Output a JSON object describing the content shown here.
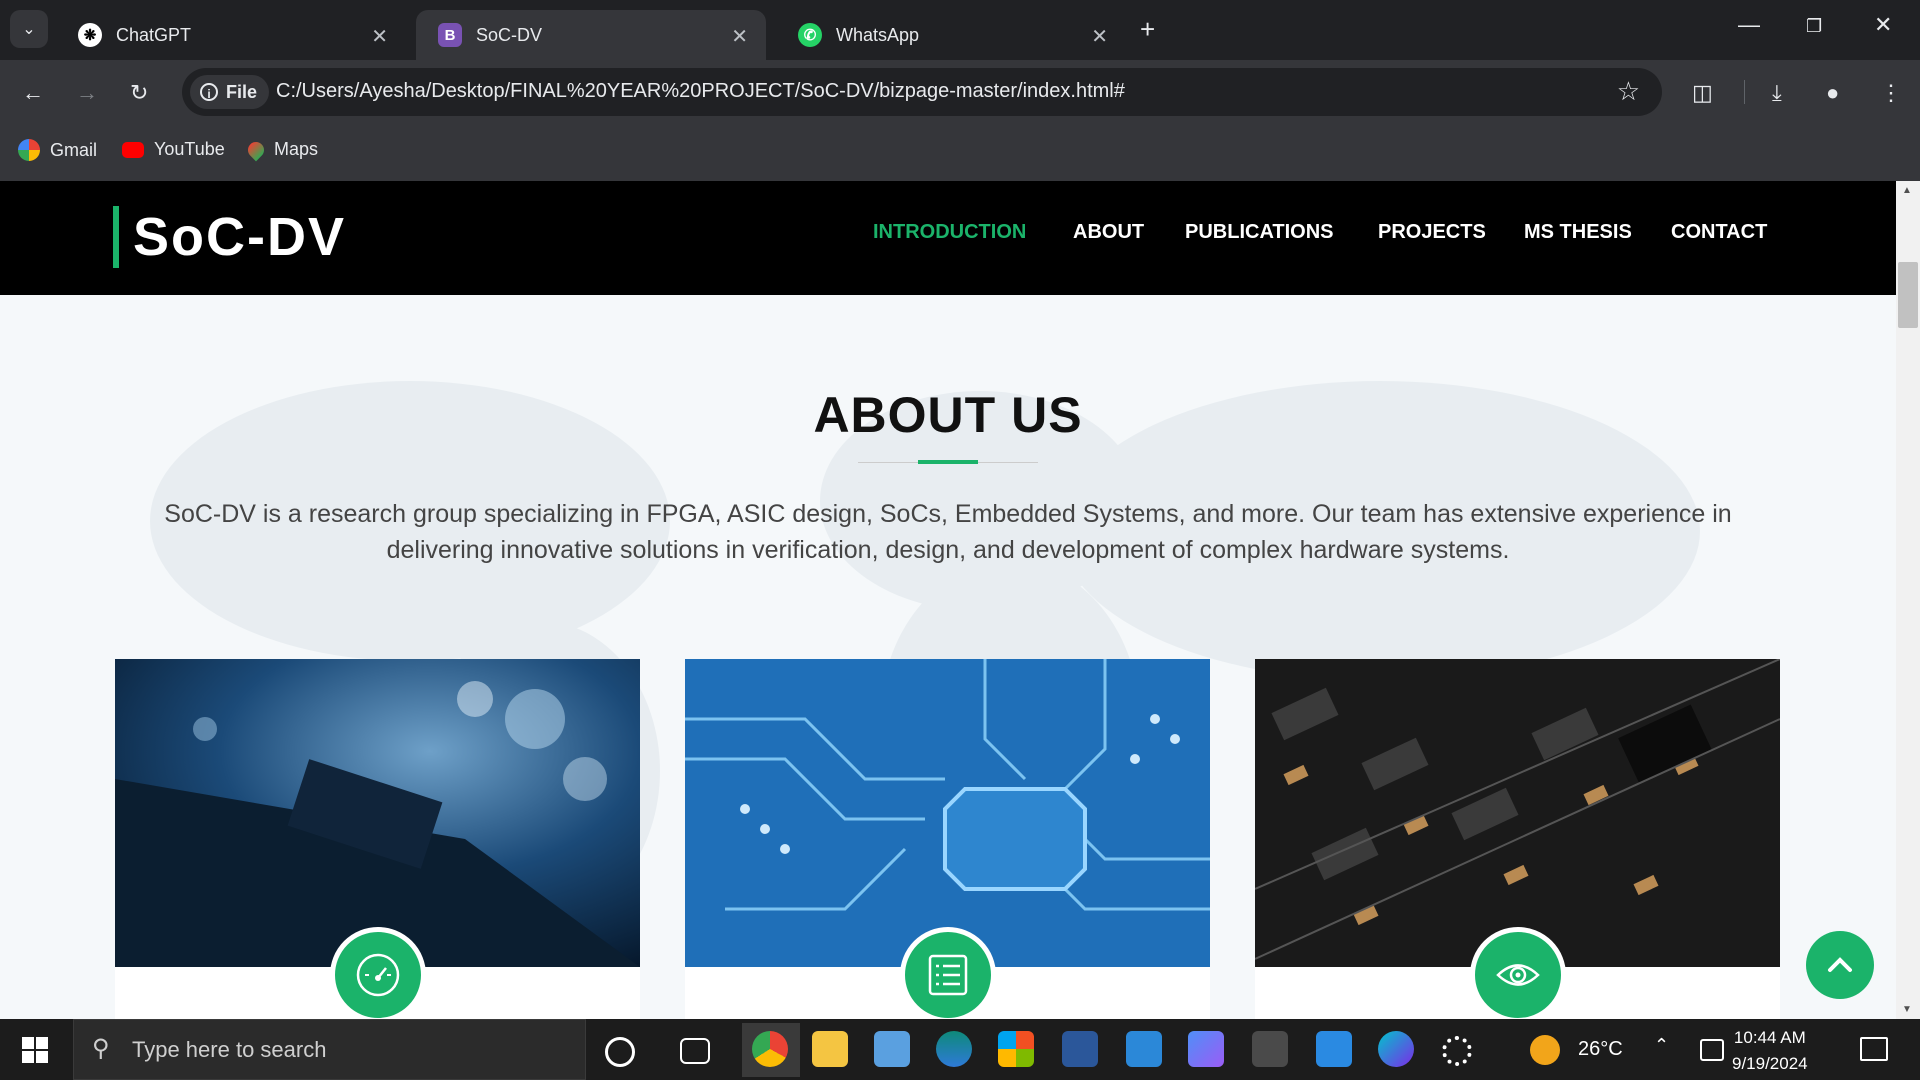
{
  "browser": {
    "tabs": [
      {
        "title": "ChatGPT",
        "active": false
      },
      {
        "title": "SoC-DV",
        "active": true
      },
      {
        "title": "WhatsApp",
        "active": false
      }
    ],
    "address_chip": "File",
    "url": "C:/Users/Ayesha/Desktop/FINAL%20YEAR%20PROJECT/SoC-DV/bizpage-master/index.html#",
    "bookmarks": [
      "Gmail",
      "YouTube",
      "Maps"
    ]
  },
  "site": {
    "logo": "SoC-DV",
    "nav": [
      "INTRODUCTION",
      "ABOUT",
      "PUBLICATIONS",
      "PROJECTS",
      "MS THESIS",
      "CONTACT"
    ],
    "active_nav": "INTRODUCTION",
    "accent": "#1bb36a",
    "about": {
      "title": "ABOUT US",
      "description": "SoC-DV is a research group specializing in FPGA, ASIC design, SoCs, Embedded Systems, and more. Our team has extensive experience in delivering innovative solutions in verification, design, and development of complex hardware systems."
    },
    "cards": [
      {
        "icon": "speedometer-icon"
      },
      {
        "icon": "list-icon"
      },
      {
        "icon": "eye-icon"
      }
    ]
  },
  "taskbar": {
    "search_placeholder": "Type here to search",
    "weather": "26°C",
    "time": "10:44 AM",
    "date": "9/19/2024"
  }
}
